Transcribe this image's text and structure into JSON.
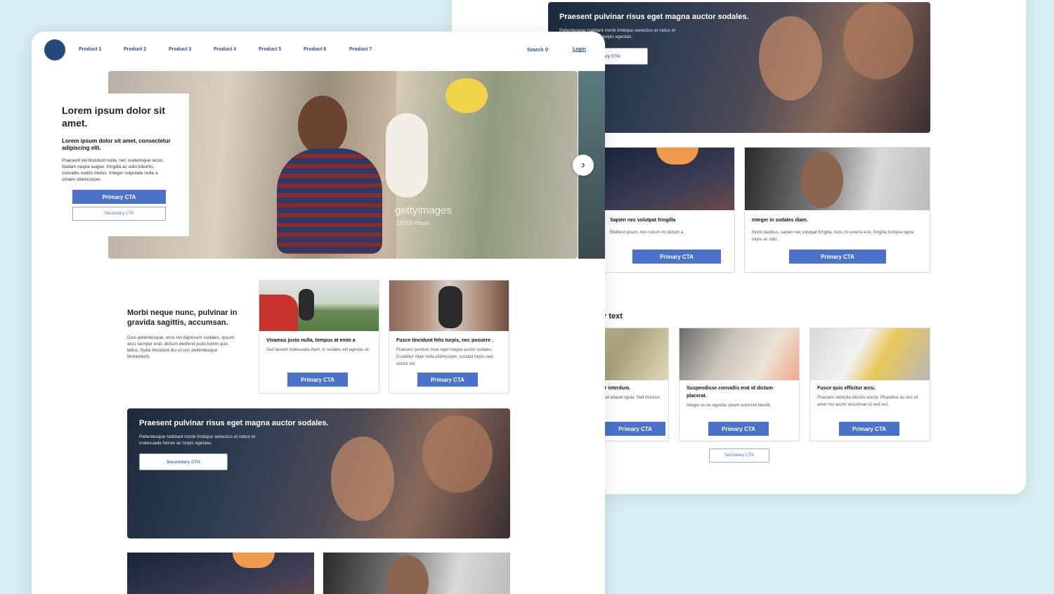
{
  "colors": {
    "accent": "#4a72c8",
    "navy": "#24497a",
    "bg": "#d8eef3"
  },
  "back": {
    "hero": {
      "title": "Praesent pulvinar risus eget magna auctor sodales.",
      "body": "Pellentesque habitant morbi tristique senectus et netus et malesuada fames ac turpis egestas.",
      "cta": "Secondary CTA"
    },
    "cards_top": [
      {
        "title": "Sapien nec volutpat fringilla",
        "body": "Eleifend ipsum, non rutrum mi dictum a.",
        "cta": "Primary CTA"
      },
      {
        "title": "Integer in sodales diam.",
        "body": "Morbi dapibus, sapien nec volutpat fringilla, nunc mi viverra erat, fringilla tristique ligula turpis ac odio.",
        "cta": "Primary CTA"
      }
    ],
    "section_heading": "Header text",
    "cards_bottom": [
      {
        "title": "Etiam auctor interdum.",
        "body": "Viverra libero, vel aliquet ligula. Sed rhoncus arcu vitae,",
        "cta": "Primary CTA"
      },
      {
        "title": "Suspendisse convallis erat id dictum placerat.",
        "body": "Integer eu ex egestas ipsum euismod blandit.",
        "cta": "Primary CTA"
      },
      {
        "title": "Fusce quis efficitur arcu.",
        "body": "Praesent vehicula lobortis auctor. Phasellus eu orci sit amet nisi auctor accumsan id sed orci.",
        "cta": "Primary CTA"
      }
    ],
    "secondary_cta": "Secondary CTA"
  },
  "front": {
    "nav": {
      "items": [
        "Product 1",
        "Product 2",
        "Product 3",
        "Product 4",
        "Product 5",
        "Product 6",
        "Product 7"
      ],
      "search": "Search",
      "login": "Login"
    },
    "hero": {
      "title": "Lorem ipsum dolor sit amet.",
      "subtitle": "Lorem ipsum dolor sit amet, consectetur adipiscing elit.",
      "body": "Praesent vel tincidunt nulla, nec scelerisque lacus. Nullam neque augue, fringilla ac odio lobortis, convallis mattis metus. Integer vulputate nulla a ornare ullamcorper.",
      "primary_cta": "Primary CTA",
      "secondary_cta": "Secondary CTA",
      "watermark": "gettyimages",
      "watermark_sub": "10'000 Hours"
    },
    "feature": {
      "title": "Morbi neque nunc, pulvinar in gravida sagittis, accumsan.",
      "body": "Duis pellentesque, eros vel dignissim sodales, ipsum arcu semper erat, dictum eleifend justo lorem quis tellus. Nulla tincidunt dui ut orci pellentesque fermentum."
    },
    "cards": [
      {
        "title": "Vivamus justo nulla, tempus at enim a",
        "body": "Sed laoreet malesuada diam, in sodales elit egestas at.",
        "cta": "Primary CTA"
      },
      {
        "title": "Fusce tincidunt felis turpis, nec posuere .",
        "body": "Praesent pulvinar risus eget magna auctor sodales. Curabitur vitae nulla ullamcorper, suscipit turpis sed, auctor est.",
        "cta": "Primary CTA"
      }
    ],
    "banner": {
      "title": "Praesent pulvinar risus eget magna auctor sodales.",
      "body": "Pellentesque habitant morbi tristique senectus et netus et malesuada fames ac turpis egestas.",
      "cta": "Secondary CTA"
    }
  }
}
